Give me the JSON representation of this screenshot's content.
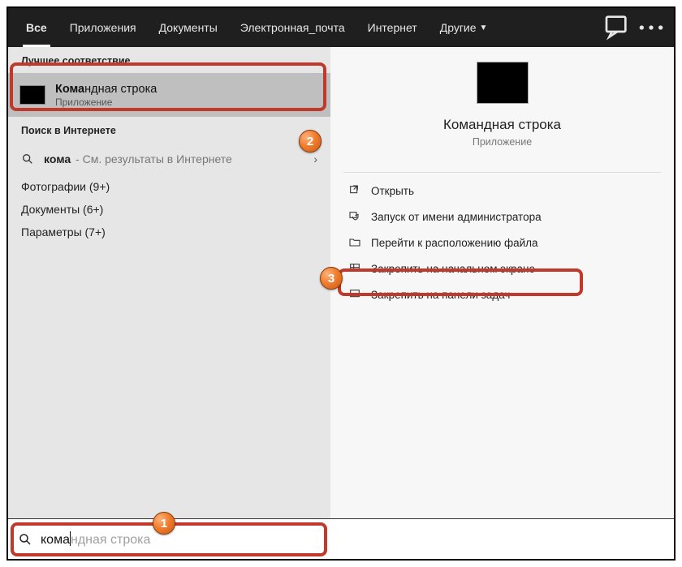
{
  "tabs": {
    "all": "Все",
    "apps": "Приложения",
    "docs": "Документы",
    "email": "Электронная_почта",
    "internet": "Интернет",
    "more": "Другие"
  },
  "left": {
    "best_match_header": "Лучшее соответствие",
    "best_match": {
      "title_hl": "Кома",
      "title_rest": "ндная строка",
      "subtitle": "Приложение"
    },
    "web_header": "Поиск в Интернете",
    "web_row": {
      "term_hl": "кома",
      "term_sub": " - См. результаты в Интернете"
    },
    "photos": "Фотографии (9+)",
    "documents": "Документы (6+)",
    "settings": "Параметры (7+)"
  },
  "right": {
    "title": "Командная строка",
    "subtitle": "Приложение",
    "actions": {
      "open": "Открыть",
      "run_admin": "Запуск от имени администратора",
      "open_location": "Перейти к расположению файла",
      "pin_start": "Закрепить на начальном экране",
      "pin_taskbar": "Закрепить на панели задач"
    }
  },
  "search": {
    "typed": "кома",
    "ghost": "ндная строка"
  },
  "badges": {
    "b1": "1",
    "b2": "2",
    "b3": "3"
  }
}
